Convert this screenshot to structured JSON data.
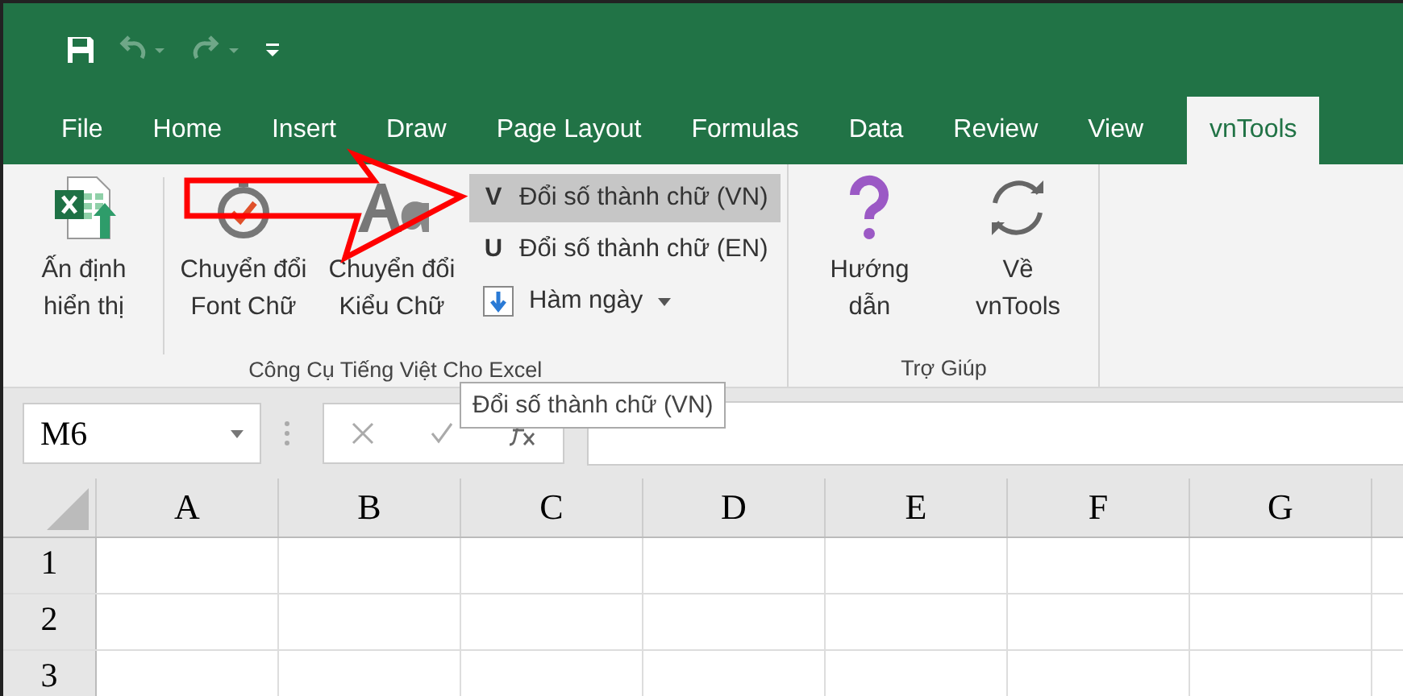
{
  "tabs": [
    {
      "label": "File",
      "selected": false
    },
    {
      "label": "Home",
      "selected": false
    },
    {
      "label": "Insert",
      "selected": false
    },
    {
      "label": "Draw",
      "selected": false
    },
    {
      "label": "Page Layout",
      "selected": false
    },
    {
      "label": "Formulas",
      "selected": false
    },
    {
      "label": "Data",
      "selected": false
    },
    {
      "label": "Review",
      "selected": false
    },
    {
      "label": "View",
      "selected": false
    },
    {
      "label": "vnTools",
      "selected": true
    }
  ],
  "ribbon": {
    "groups": [
      {
        "label": "Công Cụ Tiếng Việt Cho Excel",
        "large_buttons": [
          {
            "kind": "sheet",
            "lines": [
              "Ấn định",
              "hiển thị"
            ]
          },
          {
            "kind": "check",
            "lines": [
              "Chuyển đổi",
              "Font Chữ"
            ]
          },
          {
            "kind": "font",
            "lines": [
              "Chuyển đổi",
              "Kiểu Chữ"
            ]
          }
        ],
        "small_buttons": [
          {
            "glyph": "V",
            "label": "Đổi số thành chữ (VN)",
            "selected": true
          },
          {
            "glyph": "U",
            "label": "Đổi số thành chữ (EN)",
            "selected": false
          },
          {
            "kind": "download",
            "label": "Hàm ngày",
            "dropdown": true,
            "selected": false
          }
        ]
      },
      {
        "label": "Trợ Giúp",
        "large_buttons": [
          {
            "kind": "help",
            "lines": [
              "Hướng",
              "dẫn"
            ]
          },
          {
            "kind": "refresh",
            "lines": [
              "Về",
              "vnTools"
            ]
          }
        ]
      }
    ]
  },
  "tooltip": "Đổi số thành chữ (VN)",
  "name_box": "M6",
  "columns": [
    "A",
    "B",
    "C",
    "D",
    "E",
    "F",
    "G"
  ],
  "rows": [
    "1",
    "2",
    "3"
  ]
}
